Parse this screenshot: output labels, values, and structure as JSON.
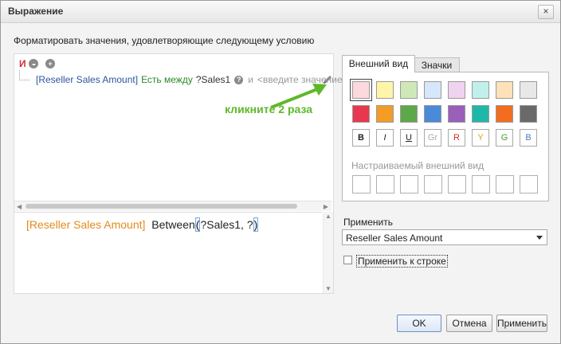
{
  "window": {
    "title": "Выражение",
    "close_glyph": "×"
  },
  "subtitle": "Форматировать значения, удовлетворяющие следующему условию",
  "condition": {
    "group_operator": "И",
    "group_menu_glyph": "•••",
    "add_glyph": "+",
    "field": "[Reseller Sales Amount]",
    "operator": "Есть между",
    "parameter": "?Sales1",
    "help_glyph": "?",
    "and_word": "и",
    "placeholder": "<введите значение>",
    "hint": "кликните 2 раза"
  },
  "expression": {
    "field": "[Reseller Sales Amount]",
    "function": "Between",
    "open_paren": "(",
    "args": "?Sales1, ?",
    "close_paren": ")"
  },
  "tabs": [
    "Внешний вид",
    "Значки"
  ],
  "swatches_row1": [
    "#fcd9df",
    "#fff5a8",
    "#cfe8b8",
    "#d6e7f9",
    "#f0d3f0",
    "#bff0ec",
    "#fde1b8",
    "#e8e8e8"
  ],
  "swatches_row2": [
    "#e8384f",
    "#f39c26",
    "#5fa84a",
    "#4a8ad8",
    "#9a5fb8",
    "#1fb8a8",
    "#f36d20",
    "#6a6a6a"
  ],
  "format_buttons": [
    {
      "label": "B",
      "color": "#222222"
    },
    {
      "label": "I",
      "color": "#222222"
    },
    {
      "label": "U",
      "color": "#222222"
    },
    {
      "label": "Gr",
      "color": "#aaaaaa"
    },
    {
      "label": "R",
      "color": "#d03030"
    },
    {
      "label": "Y",
      "color": "#e0a020"
    },
    {
      "label": "G",
      "color": "#4a9a30"
    },
    {
      "label": "B",
      "color": "#4a7ac8"
    }
  ],
  "custom_title": "Настраиваемый внешний вид",
  "apply_label": "Применить",
  "apply_value": "Reseller Sales Amount",
  "apply_row_label": "Применить к строке",
  "buttons": {
    "ok": "OK",
    "cancel": "Отмена",
    "apply": "Применить"
  },
  "colors": {
    "accent_green": "#5fb82b",
    "field_orange": "#e38b1c",
    "field_blue": "#2a55a0"
  }
}
